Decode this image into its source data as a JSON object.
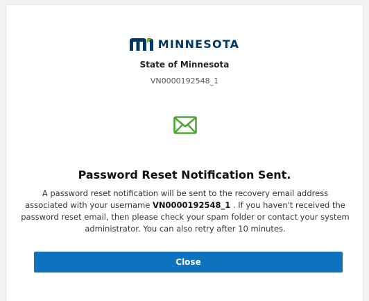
{
  "brand": {
    "logo_icon": "minnesota-mn-logo-icon",
    "logo_text": "MINNESOTA",
    "logo_color": "#003865",
    "accent_green": "#78be21"
  },
  "org_name": "State of Minnesota",
  "vendor_id": "VN0000192548_1",
  "status_icon": "envelope-icon",
  "status_icon_color": "#4aa832",
  "heading": "Password Reset Notification Sent.",
  "message": {
    "before": "A password reset notification will be sent to the recovery email address associated with your username ",
    "username": "VN0000192548_1",
    "after": " . If you haven't received the password reset email, then please check your spam folder or contact your system administrator. You can also retry after 10 minutes."
  },
  "close_button": {
    "label": "Close",
    "color": "#0e72bf"
  }
}
